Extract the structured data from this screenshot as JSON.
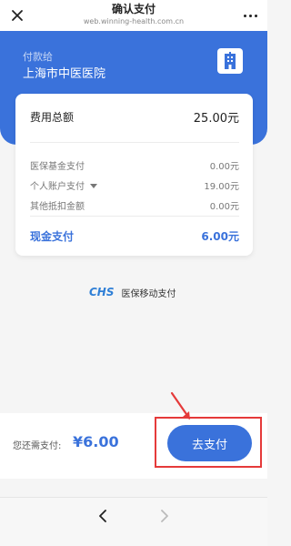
{
  "window": {
    "title": "确认支付",
    "url": "web.winning-health.com.cn",
    "close_icon": "close-icon",
    "more_icon": "more-horizontal-icon"
  },
  "header": {
    "payee_label": "付款给",
    "payee_name": "上海市中医医院",
    "hospital_icon": "hospital-building-icon",
    "background_color": "#3a72db"
  },
  "summary": {
    "total_label": "费用总额",
    "total_amount": "25.00元",
    "details": [
      {
        "label": "医保基金支付",
        "value": "0.00元"
      },
      {
        "label": "个人账户支付",
        "value": "19.00元"
      },
      {
        "label": "其他抵扣金额",
        "value": "0.00元"
      }
    ],
    "cash_label": "现金支付",
    "cash_amount": "6.00元"
  },
  "brand": {
    "logo_text": "CHS",
    "caption": "医保移动支付"
  },
  "payment": {
    "due_label": "您还需支付:",
    "due_amount": "¥6.00",
    "button_label": "去支付",
    "accent_color": "#3a72db",
    "annotation_color": "#e53a3a"
  },
  "navigation": {
    "back_icon": "chevron-left-icon",
    "forward_icon": "chevron-right-icon"
  }
}
